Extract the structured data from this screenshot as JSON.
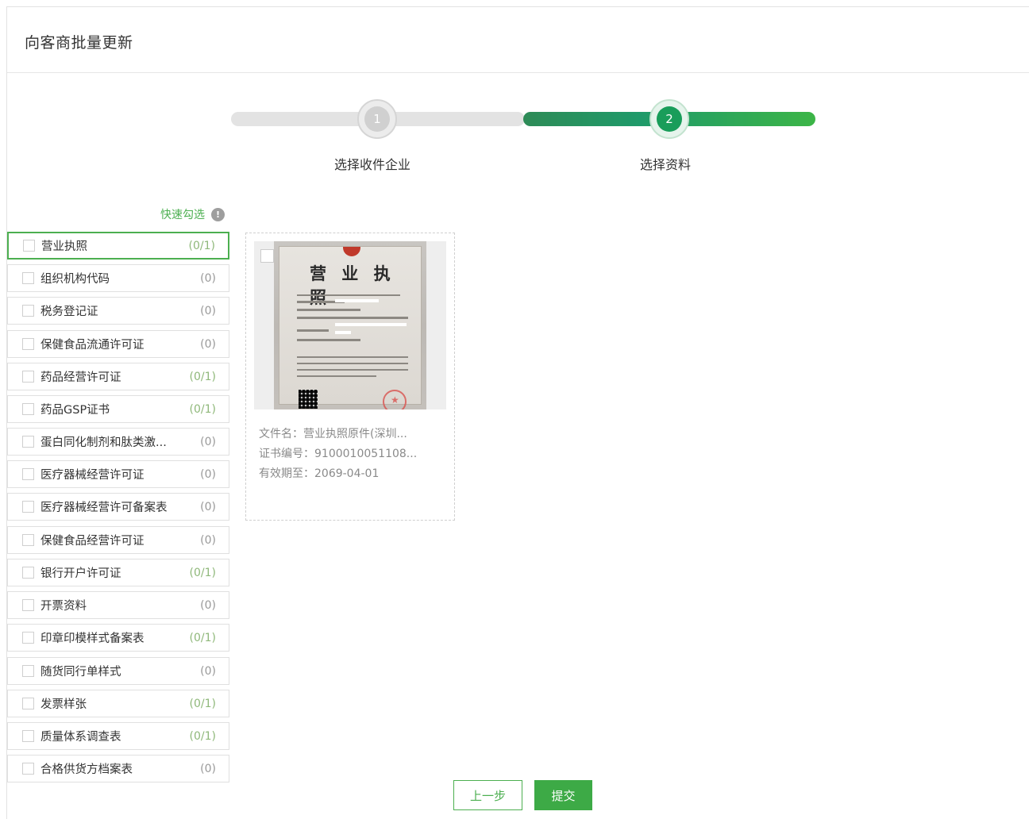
{
  "header": {
    "title": "向客商批量更新"
  },
  "stepper": {
    "steps": [
      {
        "number": "1",
        "label": "选择收件企业"
      },
      {
        "number": "2",
        "label": "选择资料"
      }
    ]
  },
  "quick_select": {
    "label": "快速勾选",
    "info_glyph": "!"
  },
  "categories": [
    {
      "name": "营业执照",
      "count": "(0/1)"
    },
    {
      "name": "组织机构代码",
      "count": "(0)"
    },
    {
      "name": "税务登记证",
      "count": "(0)"
    },
    {
      "name": "保健食品流通许可证",
      "count": "(0)"
    },
    {
      "name": "药品经营许可证",
      "count": "(0/1)"
    },
    {
      "name": "药品GSP证书",
      "count": "(0/1)"
    },
    {
      "name": "蛋白同化制剂和肽类激...",
      "count": "(0)"
    },
    {
      "name": "医疗器械经营许可证",
      "count": "(0)"
    },
    {
      "name": "医疗器械经营许可备案表",
      "count": "(0)"
    },
    {
      "name": "保健食品经营许可证",
      "count": "(0)"
    },
    {
      "name": "银行开户许可证",
      "count": "(0/1)"
    },
    {
      "name": "开票资料",
      "count": "(0)"
    },
    {
      "name": "印章印模样式备案表",
      "count": "(0/1)"
    },
    {
      "name": "随货同行单样式",
      "count": "(0)"
    },
    {
      "name": "发票样张",
      "count": "(0/1)"
    },
    {
      "name": "质量体系调查表",
      "count": "(0/1)"
    },
    {
      "name": "合格供货方档案表",
      "count": "(0)"
    }
  ],
  "document": {
    "image_title": "营 业 执 照",
    "file_name": "文件名：营业执照原件(深圳...",
    "cert_number": "证书编号：9100010051108...",
    "valid_until": "有效期至：2069-04-01"
  },
  "buttons": {
    "prev": "上一步",
    "submit": "提交"
  },
  "colors": {
    "accent": "#3daa46",
    "step_active": "#199d5a",
    "count_highlight": "#8fb87a"
  }
}
